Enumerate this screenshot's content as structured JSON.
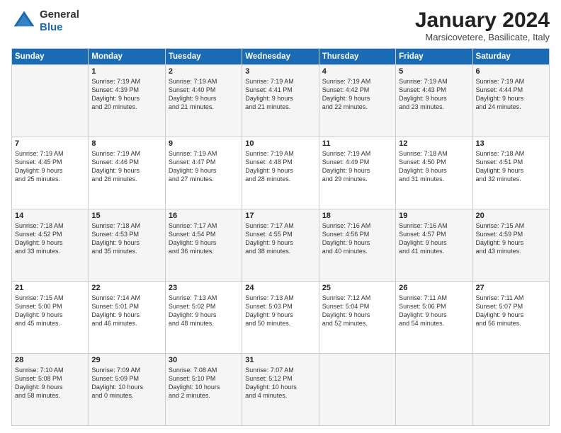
{
  "header": {
    "logo_general": "General",
    "logo_blue": "Blue",
    "month_title": "January 2024",
    "subtitle": "Marsicovetere, Basilicate, Italy"
  },
  "weekdays": [
    "Sunday",
    "Monday",
    "Tuesday",
    "Wednesday",
    "Thursday",
    "Friday",
    "Saturday"
  ],
  "weeks": [
    [
      {
        "day": "",
        "info": ""
      },
      {
        "day": "1",
        "info": "Sunrise: 7:19 AM\nSunset: 4:39 PM\nDaylight: 9 hours\nand 20 minutes."
      },
      {
        "day": "2",
        "info": "Sunrise: 7:19 AM\nSunset: 4:40 PM\nDaylight: 9 hours\nand 21 minutes."
      },
      {
        "day": "3",
        "info": "Sunrise: 7:19 AM\nSunset: 4:41 PM\nDaylight: 9 hours\nand 21 minutes."
      },
      {
        "day": "4",
        "info": "Sunrise: 7:19 AM\nSunset: 4:42 PM\nDaylight: 9 hours\nand 22 minutes."
      },
      {
        "day": "5",
        "info": "Sunrise: 7:19 AM\nSunset: 4:43 PM\nDaylight: 9 hours\nand 23 minutes."
      },
      {
        "day": "6",
        "info": "Sunrise: 7:19 AM\nSunset: 4:44 PM\nDaylight: 9 hours\nand 24 minutes."
      }
    ],
    [
      {
        "day": "7",
        "info": "Sunrise: 7:19 AM\nSunset: 4:45 PM\nDaylight: 9 hours\nand 25 minutes."
      },
      {
        "day": "8",
        "info": "Sunrise: 7:19 AM\nSunset: 4:46 PM\nDaylight: 9 hours\nand 26 minutes."
      },
      {
        "day": "9",
        "info": "Sunrise: 7:19 AM\nSunset: 4:47 PM\nDaylight: 9 hours\nand 27 minutes."
      },
      {
        "day": "10",
        "info": "Sunrise: 7:19 AM\nSunset: 4:48 PM\nDaylight: 9 hours\nand 28 minutes."
      },
      {
        "day": "11",
        "info": "Sunrise: 7:19 AM\nSunset: 4:49 PM\nDaylight: 9 hours\nand 29 minutes."
      },
      {
        "day": "12",
        "info": "Sunrise: 7:18 AM\nSunset: 4:50 PM\nDaylight: 9 hours\nand 31 minutes."
      },
      {
        "day": "13",
        "info": "Sunrise: 7:18 AM\nSunset: 4:51 PM\nDaylight: 9 hours\nand 32 minutes."
      }
    ],
    [
      {
        "day": "14",
        "info": "Sunrise: 7:18 AM\nSunset: 4:52 PM\nDaylight: 9 hours\nand 33 minutes."
      },
      {
        "day": "15",
        "info": "Sunrise: 7:18 AM\nSunset: 4:53 PM\nDaylight: 9 hours\nand 35 minutes."
      },
      {
        "day": "16",
        "info": "Sunrise: 7:17 AM\nSunset: 4:54 PM\nDaylight: 9 hours\nand 36 minutes."
      },
      {
        "day": "17",
        "info": "Sunrise: 7:17 AM\nSunset: 4:55 PM\nDaylight: 9 hours\nand 38 minutes."
      },
      {
        "day": "18",
        "info": "Sunrise: 7:16 AM\nSunset: 4:56 PM\nDaylight: 9 hours\nand 40 minutes."
      },
      {
        "day": "19",
        "info": "Sunrise: 7:16 AM\nSunset: 4:57 PM\nDaylight: 9 hours\nand 41 minutes."
      },
      {
        "day": "20",
        "info": "Sunrise: 7:15 AM\nSunset: 4:59 PM\nDaylight: 9 hours\nand 43 minutes."
      }
    ],
    [
      {
        "day": "21",
        "info": "Sunrise: 7:15 AM\nSunset: 5:00 PM\nDaylight: 9 hours\nand 45 minutes."
      },
      {
        "day": "22",
        "info": "Sunrise: 7:14 AM\nSunset: 5:01 PM\nDaylight: 9 hours\nand 46 minutes."
      },
      {
        "day": "23",
        "info": "Sunrise: 7:13 AM\nSunset: 5:02 PM\nDaylight: 9 hours\nand 48 minutes."
      },
      {
        "day": "24",
        "info": "Sunrise: 7:13 AM\nSunset: 5:03 PM\nDaylight: 9 hours\nand 50 minutes."
      },
      {
        "day": "25",
        "info": "Sunrise: 7:12 AM\nSunset: 5:04 PM\nDaylight: 9 hours\nand 52 minutes."
      },
      {
        "day": "26",
        "info": "Sunrise: 7:11 AM\nSunset: 5:06 PM\nDaylight: 9 hours\nand 54 minutes."
      },
      {
        "day": "27",
        "info": "Sunrise: 7:11 AM\nSunset: 5:07 PM\nDaylight: 9 hours\nand 56 minutes."
      }
    ],
    [
      {
        "day": "28",
        "info": "Sunrise: 7:10 AM\nSunset: 5:08 PM\nDaylight: 9 hours\nand 58 minutes."
      },
      {
        "day": "29",
        "info": "Sunrise: 7:09 AM\nSunset: 5:09 PM\nDaylight: 10 hours\nand 0 minutes."
      },
      {
        "day": "30",
        "info": "Sunrise: 7:08 AM\nSunset: 5:10 PM\nDaylight: 10 hours\nand 2 minutes."
      },
      {
        "day": "31",
        "info": "Sunrise: 7:07 AM\nSunset: 5:12 PM\nDaylight: 10 hours\nand 4 minutes."
      },
      {
        "day": "",
        "info": ""
      },
      {
        "day": "",
        "info": ""
      },
      {
        "day": "",
        "info": ""
      }
    ]
  ]
}
